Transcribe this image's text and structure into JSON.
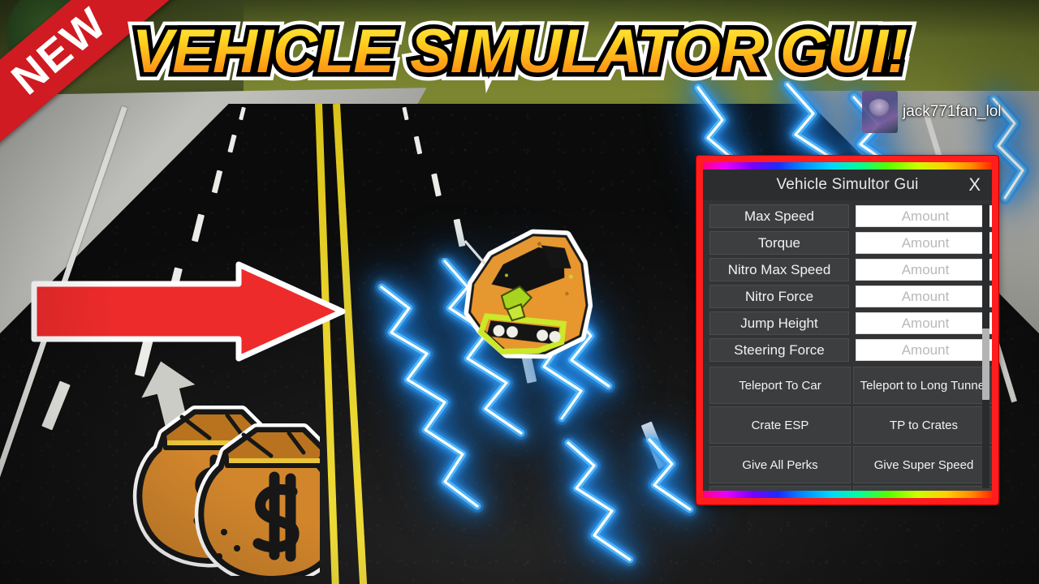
{
  "thumbnail": {
    "big_title": "VEHICLE SIMULATOR GUI!",
    "ribbon_label": "NEW",
    "username": "jack771fan_lol"
  },
  "gui": {
    "window_title": "Vehicle Simultor Gui",
    "close_label": "X",
    "fields": [
      {
        "label": "Max Speed",
        "placeholder": "Amount",
        "value": ""
      },
      {
        "label": "Torque",
        "placeholder": "Amount",
        "value": ""
      },
      {
        "label": "Nitro Max Speed",
        "placeholder": "Amount",
        "value": ""
      },
      {
        "label": "Nitro Force",
        "placeholder": "Amount",
        "value": ""
      },
      {
        "label": "Jump Height",
        "placeholder": "Amount",
        "value": ""
      },
      {
        "label": "Steering Force",
        "placeholder": "Amount",
        "value": ""
      }
    ],
    "actions": [
      "Teleport To Car",
      "Teleport to Long Tunnel",
      "Crate ESP",
      "TP to Crates",
      "Give All Perks",
      "Give Super Speed"
    ],
    "colors": {
      "border": "#ff1d1d",
      "panel": "#323334",
      "titlebar": "#2c2d2e",
      "button": "#3c3d3e",
      "input_bg": "#ffffff",
      "placeholder": "#b9b9b9",
      "text": "#f2f2f2"
    }
  },
  "scene": {
    "arrow_color": "#ee2b2b",
    "moneybag_color": "#d2862c",
    "car_color": "#e8962e",
    "lightning_color": "#5ec4ff",
    "road_color": "#151515",
    "center_line_color": "#e8d22a"
  }
}
